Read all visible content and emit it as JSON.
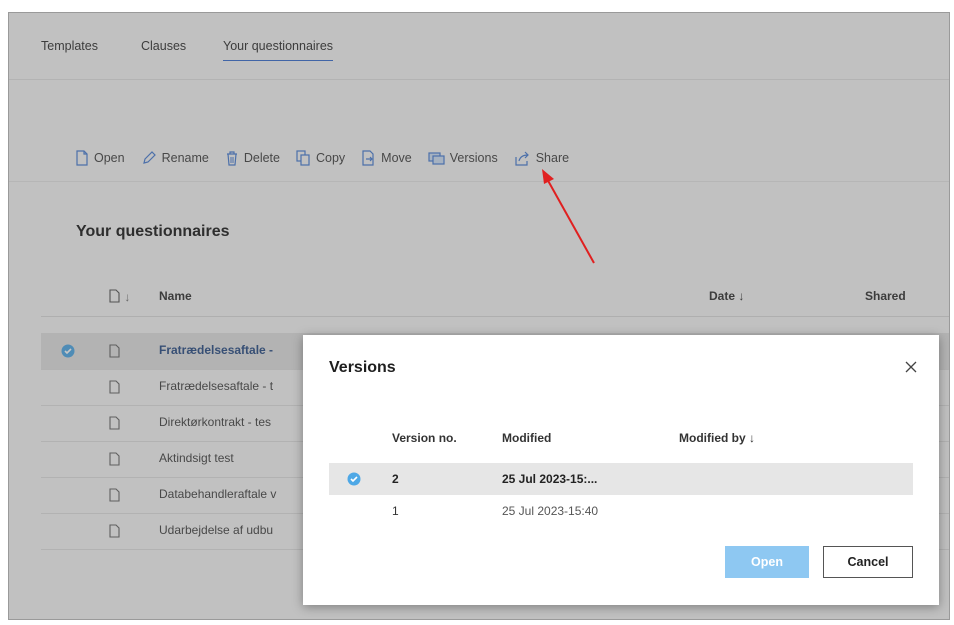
{
  "tabs": [
    {
      "label": "Templates"
    },
    {
      "label": "Clauses"
    },
    {
      "label": "Your questionnaires",
      "active": true
    }
  ],
  "toolbar": {
    "open": "Open",
    "rename": "Rename",
    "delete": "Delete",
    "copy": "Copy",
    "move": "Move",
    "versions": "Versions",
    "share": "Share"
  },
  "section_title": "Your questionnaires",
  "list": {
    "headers": {
      "type_sort": "↓",
      "name": "Name",
      "date": "Date ↓",
      "shared": "Shared"
    },
    "rows": [
      {
        "name": "Fratrædelsesaftale -",
        "selected": true
      },
      {
        "name": "Fratrædelsesaftale - t"
      },
      {
        "name": "Direktørkontrakt - tes"
      },
      {
        "name": "Aktindsigt test"
      },
      {
        "name": "Databehandleraftale v"
      },
      {
        "name": "Udarbejdelse af udbu"
      }
    ]
  },
  "modal": {
    "title": "Versions",
    "headers": {
      "version_no": "Version no.",
      "modified": "Modified",
      "modified_by": "Modified by ↓"
    },
    "rows": [
      {
        "version": "2",
        "modified": "25 Jul 2023-15:...",
        "modified_by": "",
        "selected": true
      },
      {
        "version": "1",
        "modified": "25 Jul 2023-15:40",
        "modified_by": ""
      }
    ],
    "open_label": "Open",
    "cancel_label": "Cancel"
  },
  "colors": {
    "accent": "#3a6fd0",
    "check": "#4ea8e6",
    "open_button": "#8ec8f2",
    "arrow": "#e02020"
  }
}
